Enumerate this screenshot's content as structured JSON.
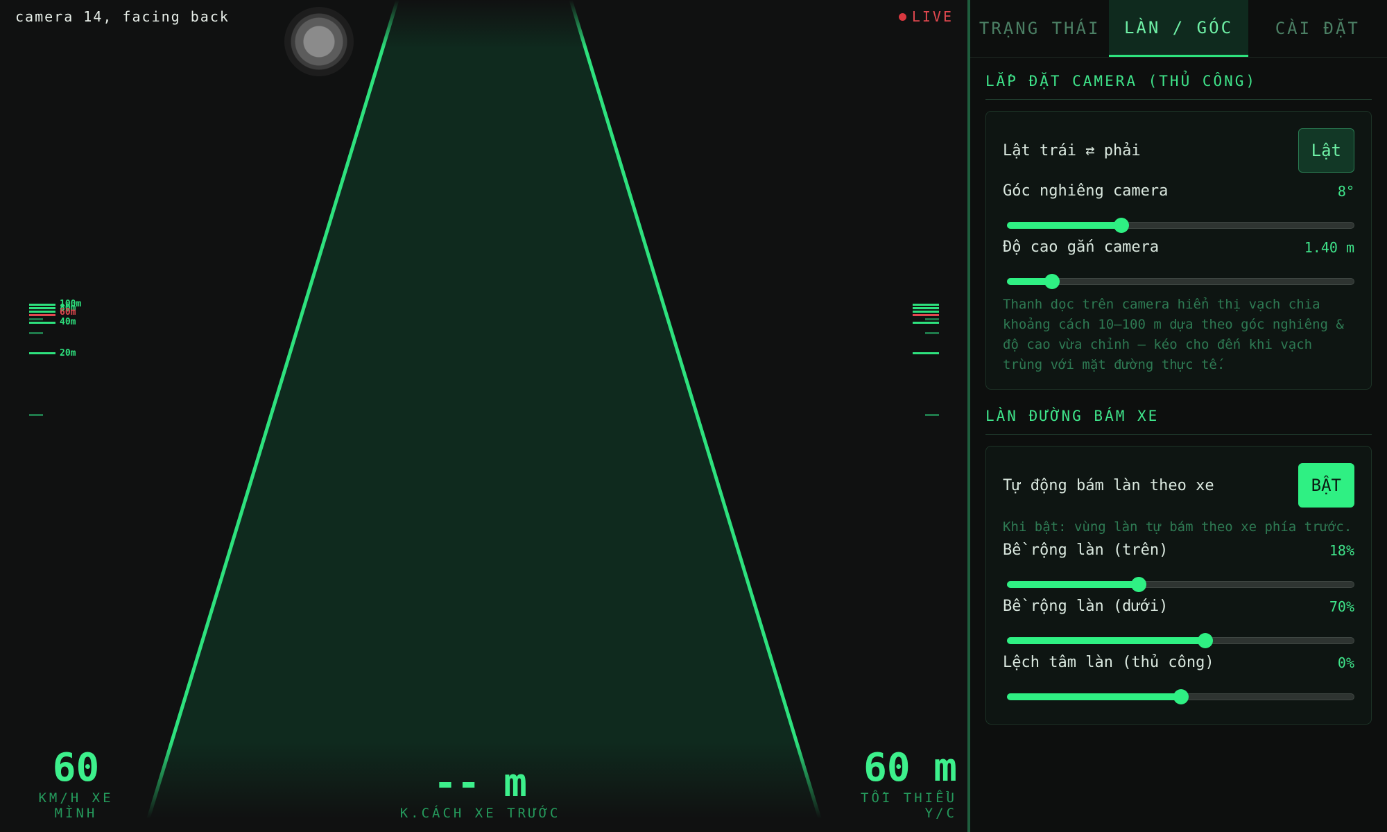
{
  "camera": {
    "label": "camera 14, facing back",
    "live_label": "LIVE",
    "live_color": "#d9383f",
    "lane_color": "#2ee27e",
    "lane_fill": "#0f2a1e",
    "ruler_left": {
      "ticks": [
        {
          "label": "100m",
          "color": "#2ee27e"
        },
        {
          "label": "80m",
          "color": "#2ee27e"
        },
        {
          "label": "60m",
          "color": "#e2484f"
        },
        {
          "label": "40m",
          "color": "#2ee27e"
        },
        {
          "label": "20m",
          "color": "#2ee27e"
        }
      ]
    }
  },
  "stats": {
    "speed": {
      "value": "60",
      "label": "KM/H XE MÌNH"
    },
    "distance": {
      "value": "-- m",
      "label": "K.CÁCH XE TRƯỚC"
    },
    "minimum": {
      "value": "60 m",
      "label": "TỐI THIỂU Y/C"
    }
  },
  "tabs": [
    {
      "label": "TRẠNG THÁI",
      "active": false
    },
    {
      "label": "LÀN / GÓC",
      "active": true
    },
    {
      "label": "CÀI ĐẶT",
      "active": false
    }
  ],
  "section_camera": {
    "title": "LẮP ĐẶT CAMERA (THỦ CÔNG)",
    "flip_label": "Lật trái ⇄ phải",
    "flip_button": "Lật",
    "tilt": {
      "label": "Góc nghiêng camera",
      "value": "8°",
      "fraction": 0.33
    },
    "height": {
      "label": "Độ cao gắn camera",
      "value": "1.40 m",
      "fraction": 0.13
    },
    "hint": "Thanh dọc trên camera hiển thị vạch chia khoảng cách 10–100 m dựa theo góc nghiêng & độ cao vừa chỉnh — kéo cho đến khi vạch trùng với mặt đường thực tế."
  },
  "section_lane": {
    "title": "LÀN ĐƯỜNG BÁM XE",
    "auto_label": "Tự động bám làn theo xe",
    "auto_button": "BẬT",
    "auto_hint": "Khi bật: vùng làn tự bám theo xe phía trước.",
    "width_top": {
      "label": "Bề rộng làn (trên)",
      "value": "18%",
      "fraction": 0.38
    },
    "width_bottom": {
      "label": "Bề rộng làn (dưới)",
      "value": "70%",
      "fraction": 0.57
    },
    "offset": {
      "label": "Lệch tâm làn (thủ công)",
      "value": "0%",
      "fraction": 0.5
    }
  }
}
